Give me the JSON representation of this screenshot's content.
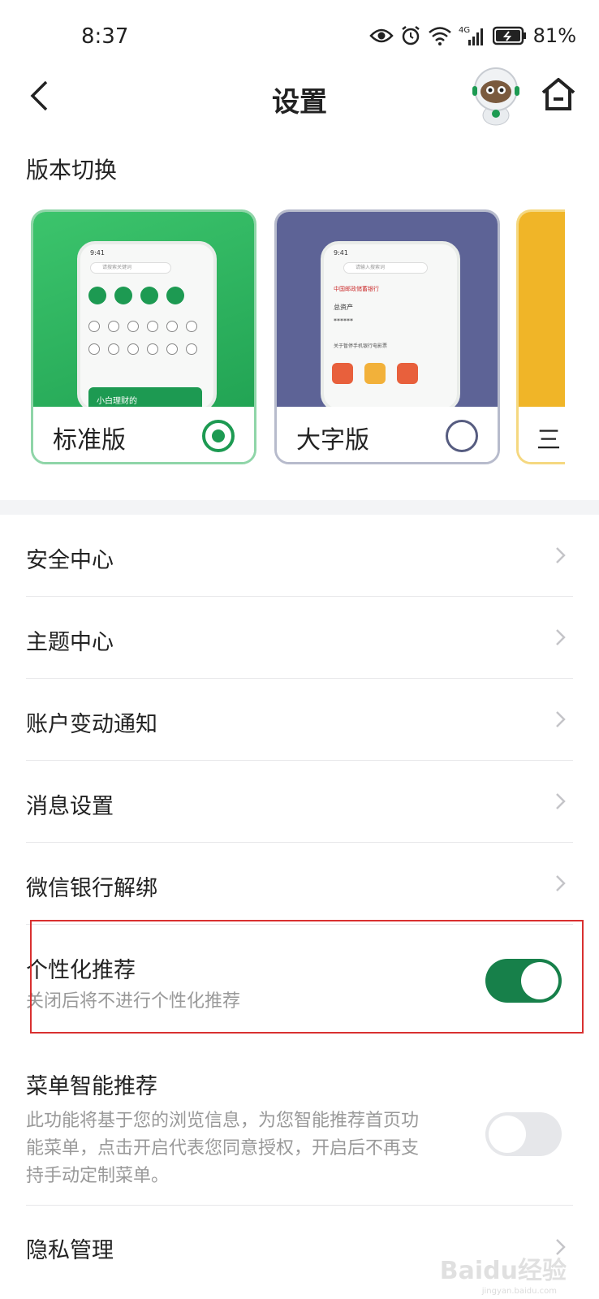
{
  "status_bar": {
    "time": "8:37",
    "battery": "81%",
    "network": "4G"
  },
  "header": {
    "title": "设置",
    "back_icon": "chevron-left-icon",
    "home_icon": "home-icon"
  },
  "version": {
    "title": "版本切换",
    "cards": [
      {
        "label": "标准版",
        "selected": true
      },
      {
        "label": "大字版",
        "selected": false
      },
      {
        "label": "三"
      }
    ],
    "preview_standard": {
      "time": "9:41",
      "search_placeholder": "请搜索关键词",
      "banner": "小白理财的"
    },
    "preview_large": {
      "time": "9:41",
      "search_placeholder": "请输入搜索词",
      "bank": "中国邮政储蓄银行",
      "assets": "总资产",
      "notice": "关于暂停手机银行电影票"
    }
  },
  "menu": [
    {
      "label": "安全中心"
    },
    {
      "label": "主题中心"
    },
    {
      "label": "账户变动通知"
    },
    {
      "label": "消息设置"
    },
    {
      "label": "微信银行解绑"
    }
  ],
  "personalized": {
    "label": "个性化推荐",
    "desc": "关闭后将不进行个性化推荐",
    "enabled": true
  },
  "menu_recommend": {
    "label": "菜单智能推荐",
    "desc_line1": "此功能将基于您的浏览信息，为您智能推荐首页功",
    "desc_line2": "能菜单，点击开启代表您同意授权，开启后不再支",
    "desc_line3": "持手动定制菜单。",
    "enabled": false
  },
  "privacy": {
    "label": "隐私管理"
  },
  "watermark": {
    "text": "Baidu经验",
    "sub": "jingyan.baidu.com"
  },
  "colors": {
    "accent": "#17804a",
    "highlight": "#d93030"
  }
}
